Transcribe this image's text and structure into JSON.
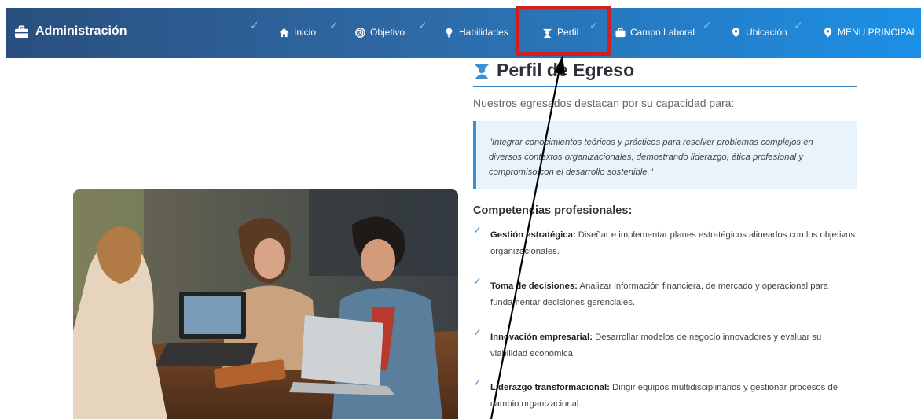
{
  "brand": {
    "title": "Administración",
    "icon": "briefcase-icon"
  },
  "nav": {
    "items": [
      {
        "label": "Inicio",
        "icon": "home-icon"
      },
      {
        "label": "Objetivo",
        "icon": "target-icon"
      },
      {
        "label": "Habilidades",
        "icon": "lightbulb-icon"
      },
      {
        "label": "Perfil",
        "icon": "graduate-icon"
      },
      {
        "label": "Campo Laboral",
        "icon": "briefcase-icon"
      },
      {
        "label": "Ubicación",
        "icon": "map-marker-icon"
      },
      {
        "label": "MENU PRINCIPAL",
        "icon": "map-marker-icon"
      }
    ]
  },
  "main": {
    "title": "Perfil de Egreso",
    "intro": "Nuestros egresados destacan por su capacidad para:",
    "quote": "\"Integrar conocimientos teóricos y prácticos para resolver problemas complejos en diversos contextos organizacionales, demostrando liderazgo, ética profesional y compromiso con el desarrollo sostenible.\"",
    "competencies_title": "Competencias profesionales:",
    "competencies": [
      {
        "name": "Gestión estratégica:",
        "desc": " Diseñar e implementar planes estratégicos alineados con los objetivos organizacionales."
      },
      {
        "name": "Toma de decisiones:",
        "desc": " Analizar información financiera, de mercado y operacional para fundamentar decisiones gerenciales."
      },
      {
        "name": "Innovación empresarial:",
        "desc": " Desarrollar modelos de negocio innovadores y evaluar su viabilidad económica."
      },
      {
        "name": "Liderazgo transformacional:",
        "desc": " Dirigir equipos multidisciplinarios y gestionar procesos de cambio organizacional."
      }
    ]
  },
  "colors": {
    "nav_start": "#2a4f7e",
    "nav_end": "#1c90e6",
    "accent": "#3b8fd4",
    "highlight": "#d11f1f"
  }
}
